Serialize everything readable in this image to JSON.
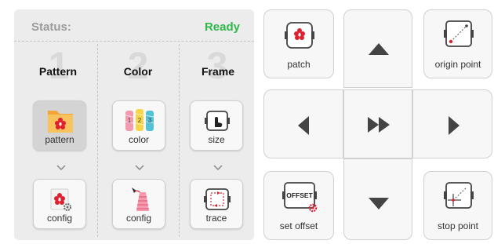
{
  "status": {
    "label": "Status:",
    "value": "Ready"
  },
  "steps": [
    {
      "number": "1",
      "title": "Pattern",
      "primary_label": "pattern",
      "secondary_label": "config"
    },
    {
      "number": "2",
      "title": "Color",
      "primary_label": "color",
      "secondary_label": "config"
    },
    {
      "number": "3",
      "title": "Frame",
      "primary_label": "size",
      "secondary_label": "trace"
    }
  ],
  "controls": {
    "patch_label": "patch",
    "origin_label": "origin point",
    "offset_label": "set offset",
    "offset_badge": "OFFSET",
    "stop_label": "stop point"
  },
  "colors": {
    "ready": "#2fb84a",
    "accent_red": "#e0202f",
    "arrow": "#444444"
  },
  "icons": [
    "folder-flower-icon",
    "thread-spools-icon",
    "frame-touch-icon",
    "flower-gear-icon",
    "thread-cone-icon",
    "frame-trace-icon",
    "flower-frame-icon",
    "origin-point-icon",
    "offset-icon",
    "stop-point-icon",
    "arrow-up-icon",
    "arrow-down-icon",
    "arrow-left-icon",
    "arrow-right-icon",
    "fast-forward-icon"
  ]
}
